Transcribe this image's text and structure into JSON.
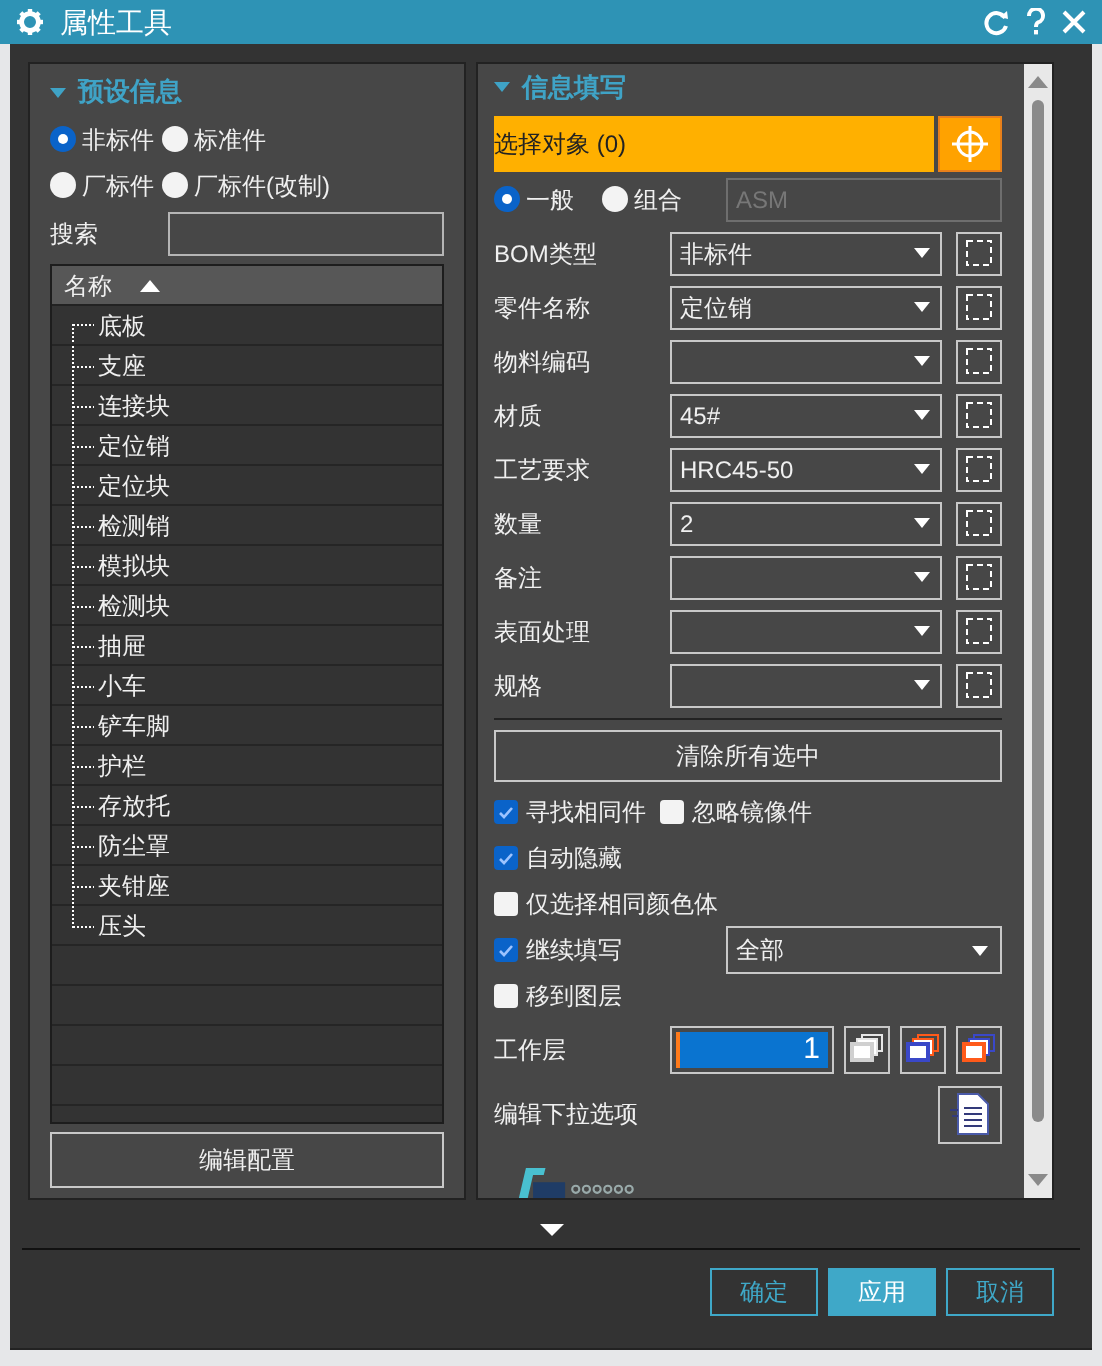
{
  "window": {
    "title": "属性工具"
  },
  "preset": {
    "title": "预设信息",
    "expanded": true,
    "radios": [
      {
        "label": "非标件",
        "selected": true
      },
      {
        "label": "标准件",
        "selected": false
      },
      {
        "label": "厂标件",
        "selected": false
      },
      {
        "label": "厂标件(改制)",
        "selected": false
      }
    ],
    "search": {
      "label": "搜索"
    },
    "table": {
      "column": "名称",
      "sort_ascending": true,
      "rows": [
        "底板",
        "支座",
        "连接块",
        "定位销",
        "定位块",
        "检测销",
        "模拟块",
        "检测块",
        "抽屉",
        "小车",
        "铲车脚",
        "护栏",
        "存放托",
        "防尘罩",
        "夹钳座",
        "压头"
      ]
    },
    "edit_button": "编辑配置"
  },
  "fill": {
    "title": "信息填写",
    "expanded": true,
    "select_object": "选择对象 (0)",
    "modes": [
      {
        "label": "一般",
        "selected": true
      },
      {
        "label": "组合",
        "selected": false
      }
    ],
    "asm_field": {
      "placeholder": "ASM",
      "disabled": true
    },
    "fields": [
      {
        "label": "BOM类型",
        "value": "非标件"
      },
      {
        "label": "零件名称",
        "value": "定位销"
      },
      {
        "label": "物料编码"
      },
      {
        "label": "材质",
        "value": "45#"
      },
      {
        "label": "工艺要求",
        "value": "HRC45-50"
      },
      {
        "label": "数量",
        "value": "2"
      },
      {
        "label": "备注"
      },
      {
        "label": "表面处理"
      },
      {
        "label": "规格"
      }
    ],
    "clear_button": "清除所有选中",
    "option_rows": [
      {
        "items": [
          {
            "label": "寻找相同件",
            "checked": true
          },
          {
            "label": "忽略镜像件",
            "checked": false
          }
        ]
      },
      {
        "items": [
          {
            "label": "自动隐藏",
            "checked": true
          }
        ]
      },
      {
        "items": [
          {
            "label": "仅选择相同颜色体",
            "checked": false
          }
        ]
      },
      {
        "items": [
          {
            "label": "继续填写",
            "checked": true
          }
        ],
        "dropdown": "全部"
      },
      {
        "items": [
          {
            "label": "移到图层",
            "checked": false
          }
        ]
      }
    ],
    "work_layer": {
      "label": "工作层",
      "value": "1"
    },
    "edit_options": {
      "label": "编辑下拉选项"
    }
  },
  "buttons": [
    {
      "label": "确定",
      "primary": false
    },
    {
      "label": "应用",
      "primary": true
    },
    {
      "label": "取消",
      "primary": false
    }
  ]
}
